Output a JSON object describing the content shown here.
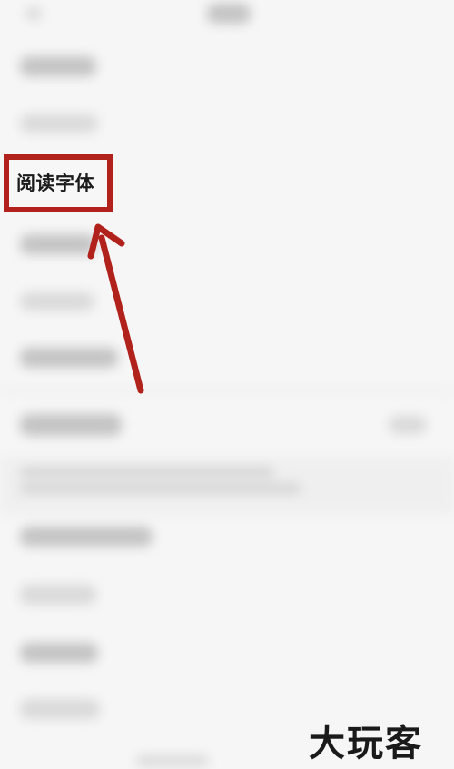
{
  "highlighted_item": {
    "label": "阅读字体"
  },
  "watermark": {
    "text": "大玩客"
  },
  "annotation": {
    "box_color": "#b1221c",
    "arrow_color": "#b1221c"
  }
}
